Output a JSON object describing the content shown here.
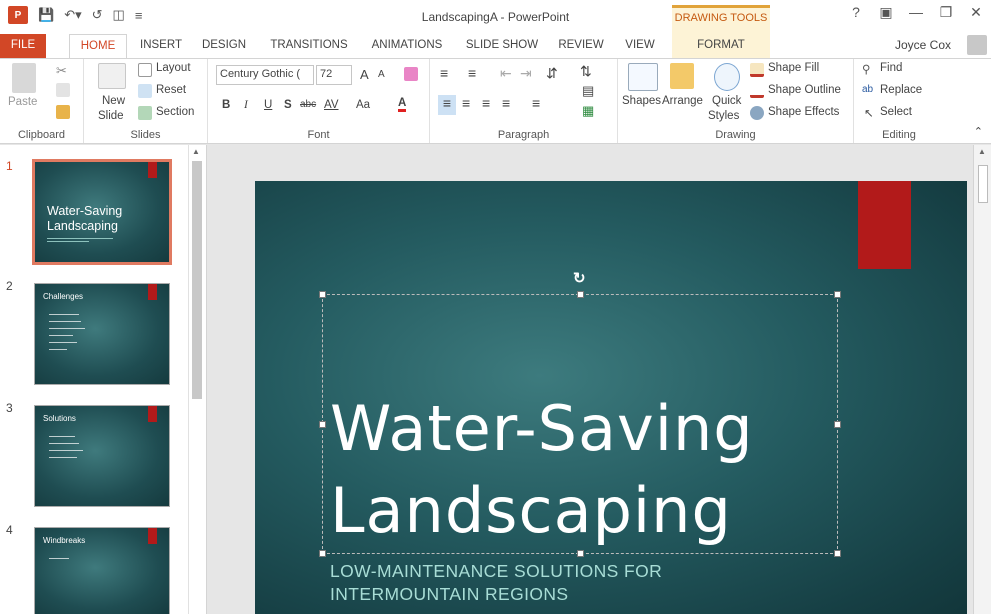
{
  "window": {
    "title": "LandscapingA - PowerPoint",
    "drawing_tools": "DRAWING TOOLS",
    "user": "Joyce Cox",
    "help": "?",
    "app_icon": "P"
  },
  "tabs": [
    "FILE",
    "HOME",
    "INSERT",
    "DESIGN",
    "TRANSITIONS",
    "ANIMATIONS",
    "SLIDE SHOW",
    "REVIEW",
    "VIEW",
    "FORMAT"
  ],
  "ribbon": {
    "clipboard": {
      "label": "Clipboard",
      "paste": "Paste"
    },
    "slides": {
      "label": "Slides",
      "new_slide_1": "New",
      "new_slide_2": "Slide",
      "layout": "Layout",
      "reset": "Reset",
      "section": "Section"
    },
    "font": {
      "label": "Font",
      "font_name": "Century Gothic (",
      "font_size": "72",
      "bold": "B",
      "italic": "I",
      "underline": "U",
      "shadow": "S",
      "strike": "abc",
      "spacing": "AV",
      "case": "Aa",
      "color": "A",
      "grow": "A",
      "shrink": "A"
    },
    "paragraph": {
      "label": "Paragraph"
    },
    "drawing": {
      "label": "Drawing",
      "shapes": "Shapes",
      "arrange": "Arrange",
      "quick_styles_1": "Quick",
      "quick_styles_2": "Styles",
      "shape_fill": "Shape Fill",
      "shape_outline": "Shape Outline",
      "shape_effects": "Shape Effects"
    },
    "editing": {
      "label": "Editing",
      "find": "Find",
      "replace": "Replace",
      "select": "Select"
    }
  },
  "thumbnails": [
    {
      "num": "1",
      "title_1": "Water-Saving",
      "title_2": "Landscaping",
      "bullets": 0
    },
    {
      "num": "2",
      "title": "Challenges",
      "bullets": 6
    },
    {
      "num": "3",
      "title": "Solutions",
      "bullets": 4
    },
    {
      "num": "4",
      "title": "Windbreaks",
      "bullets": 1
    }
  ],
  "slide": {
    "title_line1": "Water-Saving",
    "title_line2": "Landscaping",
    "subtitle_line1": "LOW-MAINTENANCE SOLUTIONS FOR",
    "subtitle_line2": "INTERMOUNTAIN REGIONS"
  },
  "colors": {
    "accent": "#d24726",
    "slide_bg": "#245b60",
    "flag": "#b21a1a",
    "subtitle": "#a8ddd6"
  }
}
